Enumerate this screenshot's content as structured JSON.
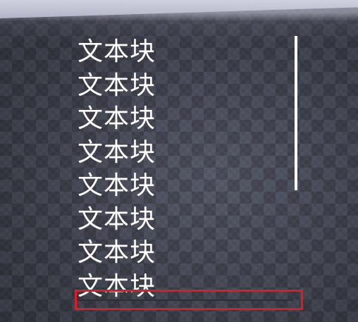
{
  "scene": {
    "background": "checkered floor",
    "colors": {
      "text": "#ffffff",
      "highlight_border": "#e01b24",
      "scrollbar": "#ffffff"
    }
  },
  "scroll_list": {
    "items": [
      {
        "label": "文本块"
      },
      {
        "label": "文本块"
      },
      {
        "label": "文本块"
      },
      {
        "label": "文本块"
      },
      {
        "label": "文本块"
      },
      {
        "label": "文本块"
      },
      {
        "label": "文本块"
      },
      {
        "label": "文本块"
      }
    ]
  },
  "vertical_scrollbar": {
    "visible": true
  },
  "horizontal_scrollbar": {
    "visible": true,
    "highlighted": true
  }
}
